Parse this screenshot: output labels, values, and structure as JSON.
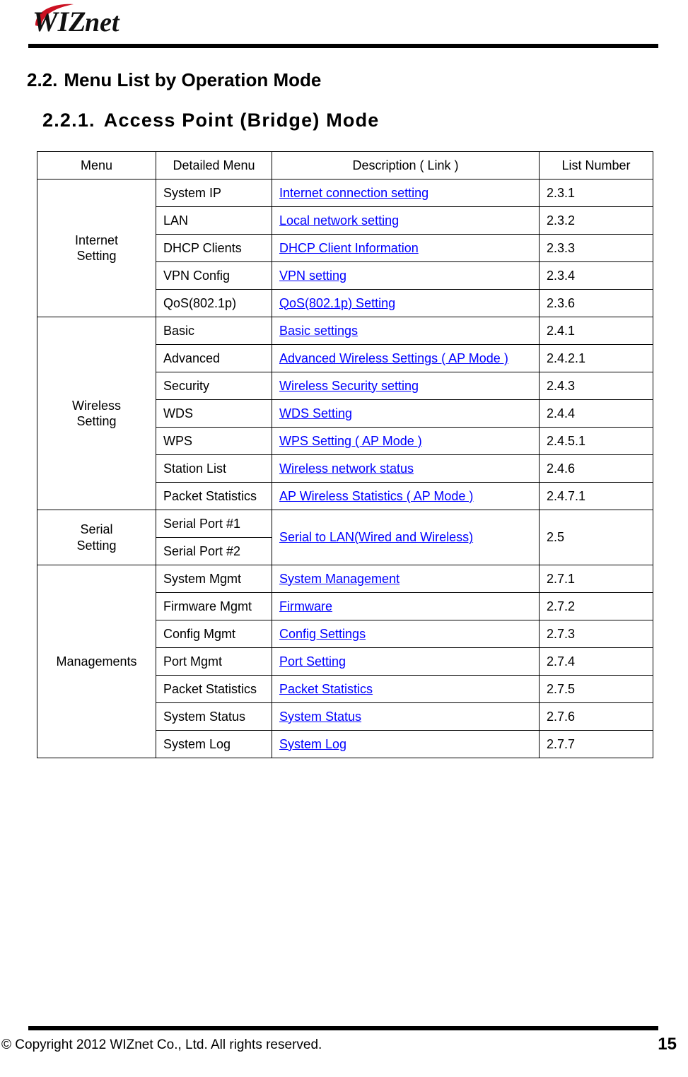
{
  "brand": {
    "logo_text": "WIZnet",
    "logo_swoosh_color": "#CC1122"
  },
  "headings": {
    "section_number": "2.2.",
    "section_title": "Menu List by Operation Mode",
    "subsection_number": "2.2.1.",
    "subsection_title": "Access  Point  (Bridge)  Mode"
  },
  "table": {
    "columns": [
      "Menu",
      "Detailed Menu",
      "Description ( Link )",
      "List Number"
    ],
    "link_color": "#0000FF",
    "groups": [
      {
        "menu": "Internet\nSetting",
        "menu_line1": "Internet",
        "menu_line2": "Setting",
        "rows": [
          {
            "detail": "System IP",
            "description": "Internet connection setting",
            "list": "2.3.1"
          },
          {
            "detail": "LAN",
            "description": "Local network setting",
            "list": "2.3.2"
          },
          {
            "detail": "DHCP Clients",
            "description": "DHCP Client Information",
            "list": "2.3.3"
          },
          {
            "detail": "VPN Config",
            "description": "VPN setting",
            "list": "2.3.4"
          },
          {
            "detail": "QoS(802.1p)",
            "description": "QoS(802.1p) Setting",
            "list": "2.3.6"
          }
        ]
      },
      {
        "menu": "Wireless\nSetting",
        "menu_line1": "Wireless",
        "menu_line2": "Setting",
        "rows": [
          {
            "detail": "Basic",
            "description": "Basic settings",
            "list": "2.4.1"
          },
          {
            "detail": "Advanced",
            "description": "Advanced Wireless Settings ( AP Mode )",
            "list": "2.4.2.1"
          },
          {
            "detail": "Security",
            "description": "Wireless Security setting",
            "list": "2.4.3"
          },
          {
            "detail": "WDS",
            "description": "WDS Setting",
            "list": "2.4.4"
          },
          {
            "detail": "WPS",
            "description": "WPS Setting ( AP Mode )",
            "list": "2.4.5.1"
          },
          {
            "detail": "Station List",
            "description": "Wireless network status",
            "list": "2.4.6"
          },
          {
            "detail": "Packet Statistics",
            "description": "AP Wireless Statistics ( AP Mode )",
            "list": "2.4.7.1"
          }
        ]
      },
      {
        "menu": "Serial\nSetting",
        "menu_line1": "Serial",
        "menu_line2": "Setting",
        "merged_description": "Serial to LAN(Wired and Wireless)",
        "merged_list": "2.5",
        "rows": [
          {
            "detail": "Serial Port #1"
          },
          {
            "detail": "Serial Port #2"
          }
        ]
      },
      {
        "menu": "Managements",
        "menu_line1": "Managements",
        "menu_line2": "",
        "rows": [
          {
            "detail": "System Mgmt",
            "description": "System Management",
            "list": "2.7.1"
          },
          {
            "detail": "Firmware Mgmt",
            "description": "Firmware",
            "list": "2.7.2"
          },
          {
            "detail": "Config Mgmt",
            "description": "Config Settings",
            "list": "2.7.3"
          },
          {
            "detail": "Port Mgmt",
            "description": "Port Setting",
            "list": "2.7.4"
          },
          {
            "detail": "Packet Statistics",
            "description": "Packet Statistics",
            "list": "2.7.5"
          },
          {
            "detail": "System Status",
            "description": "System Status",
            "list": "2.7.6"
          },
          {
            "detail": "System Log",
            "description": "System Log",
            "list": "2.7.7"
          }
        ]
      }
    ]
  },
  "footer": {
    "copyright": "© Copyright 2012 WIZnet Co., Ltd. All rights reserved.",
    "page_number": "15"
  }
}
